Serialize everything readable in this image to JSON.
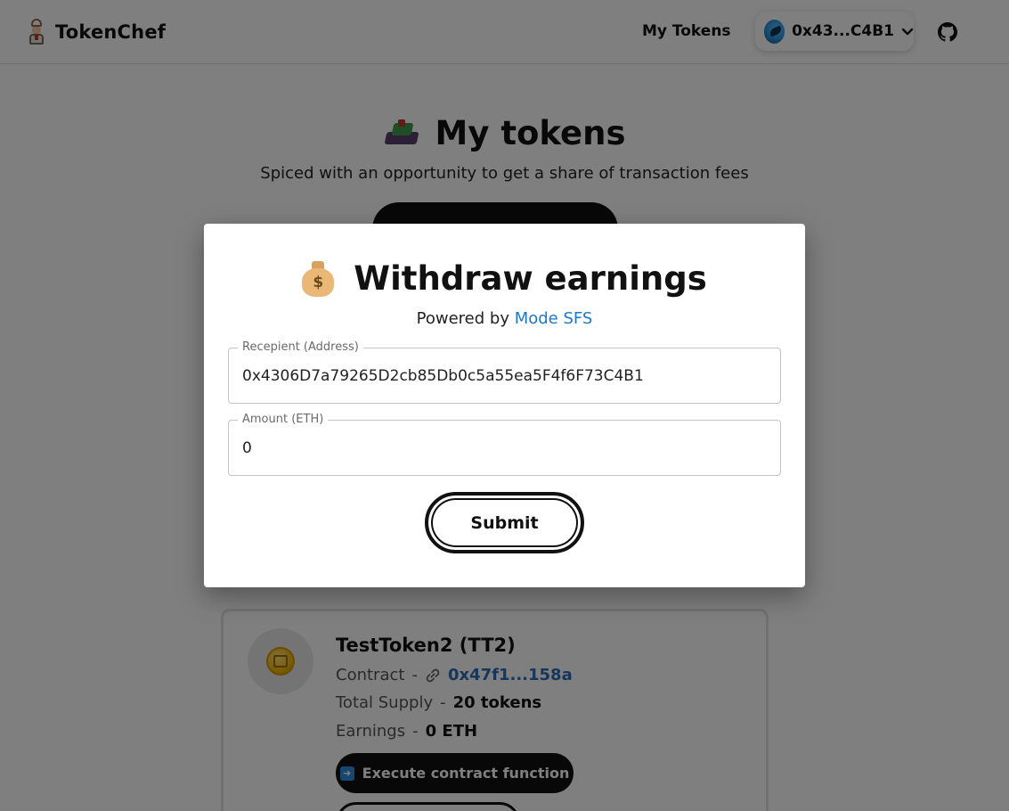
{
  "navbar": {
    "brand": "TokenChef",
    "my_tokens_link": "My Tokens",
    "wallet_address": "0x43...C4B1"
  },
  "hero": {
    "title": "My tokens",
    "subtitle": "Spiced with an opportunity to get a share of transaction fees"
  },
  "token_card": {
    "name": "TestToken2 (TT2)",
    "contract_label": "Contract",
    "contract_value": "0x47f1...158a",
    "supply_label": "Total Supply",
    "supply_value": "20 tokens",
    "earnings_label": "Earnings",
    "earnings_value": "0 ETH",
    "separator": "-",
    "execute_button": "Execute contract function"
  },
  "modal": {
    "title": "Withdraw earnings",
    "powered_prefix": "Powered by",
    "powered_link": "Mode SFS",
    "recipient_label": "Recepient (Address)",
    "recipient_value": "0x4306D7a79265D2cb85Db0c5a55ea5F4f6F73C4B1",
    "amount_label": "Amount (ETH)",
    "amount_value": "0",
    "submit_label": "Submit"
  },
  "icons": {
    "brand": "chef-logo-icon",
    "wallet": "wallet-avatar-icon",
    "chevron": "chevron-down-icon",
    "github": "github-icon",
    "hero": "bento-box-icon",
    "modal": "money-bag-icon",
    "token": "coin-icon",
    "contract": "link-icon",
    "execute": "arrow-right-icon"
  }
}
